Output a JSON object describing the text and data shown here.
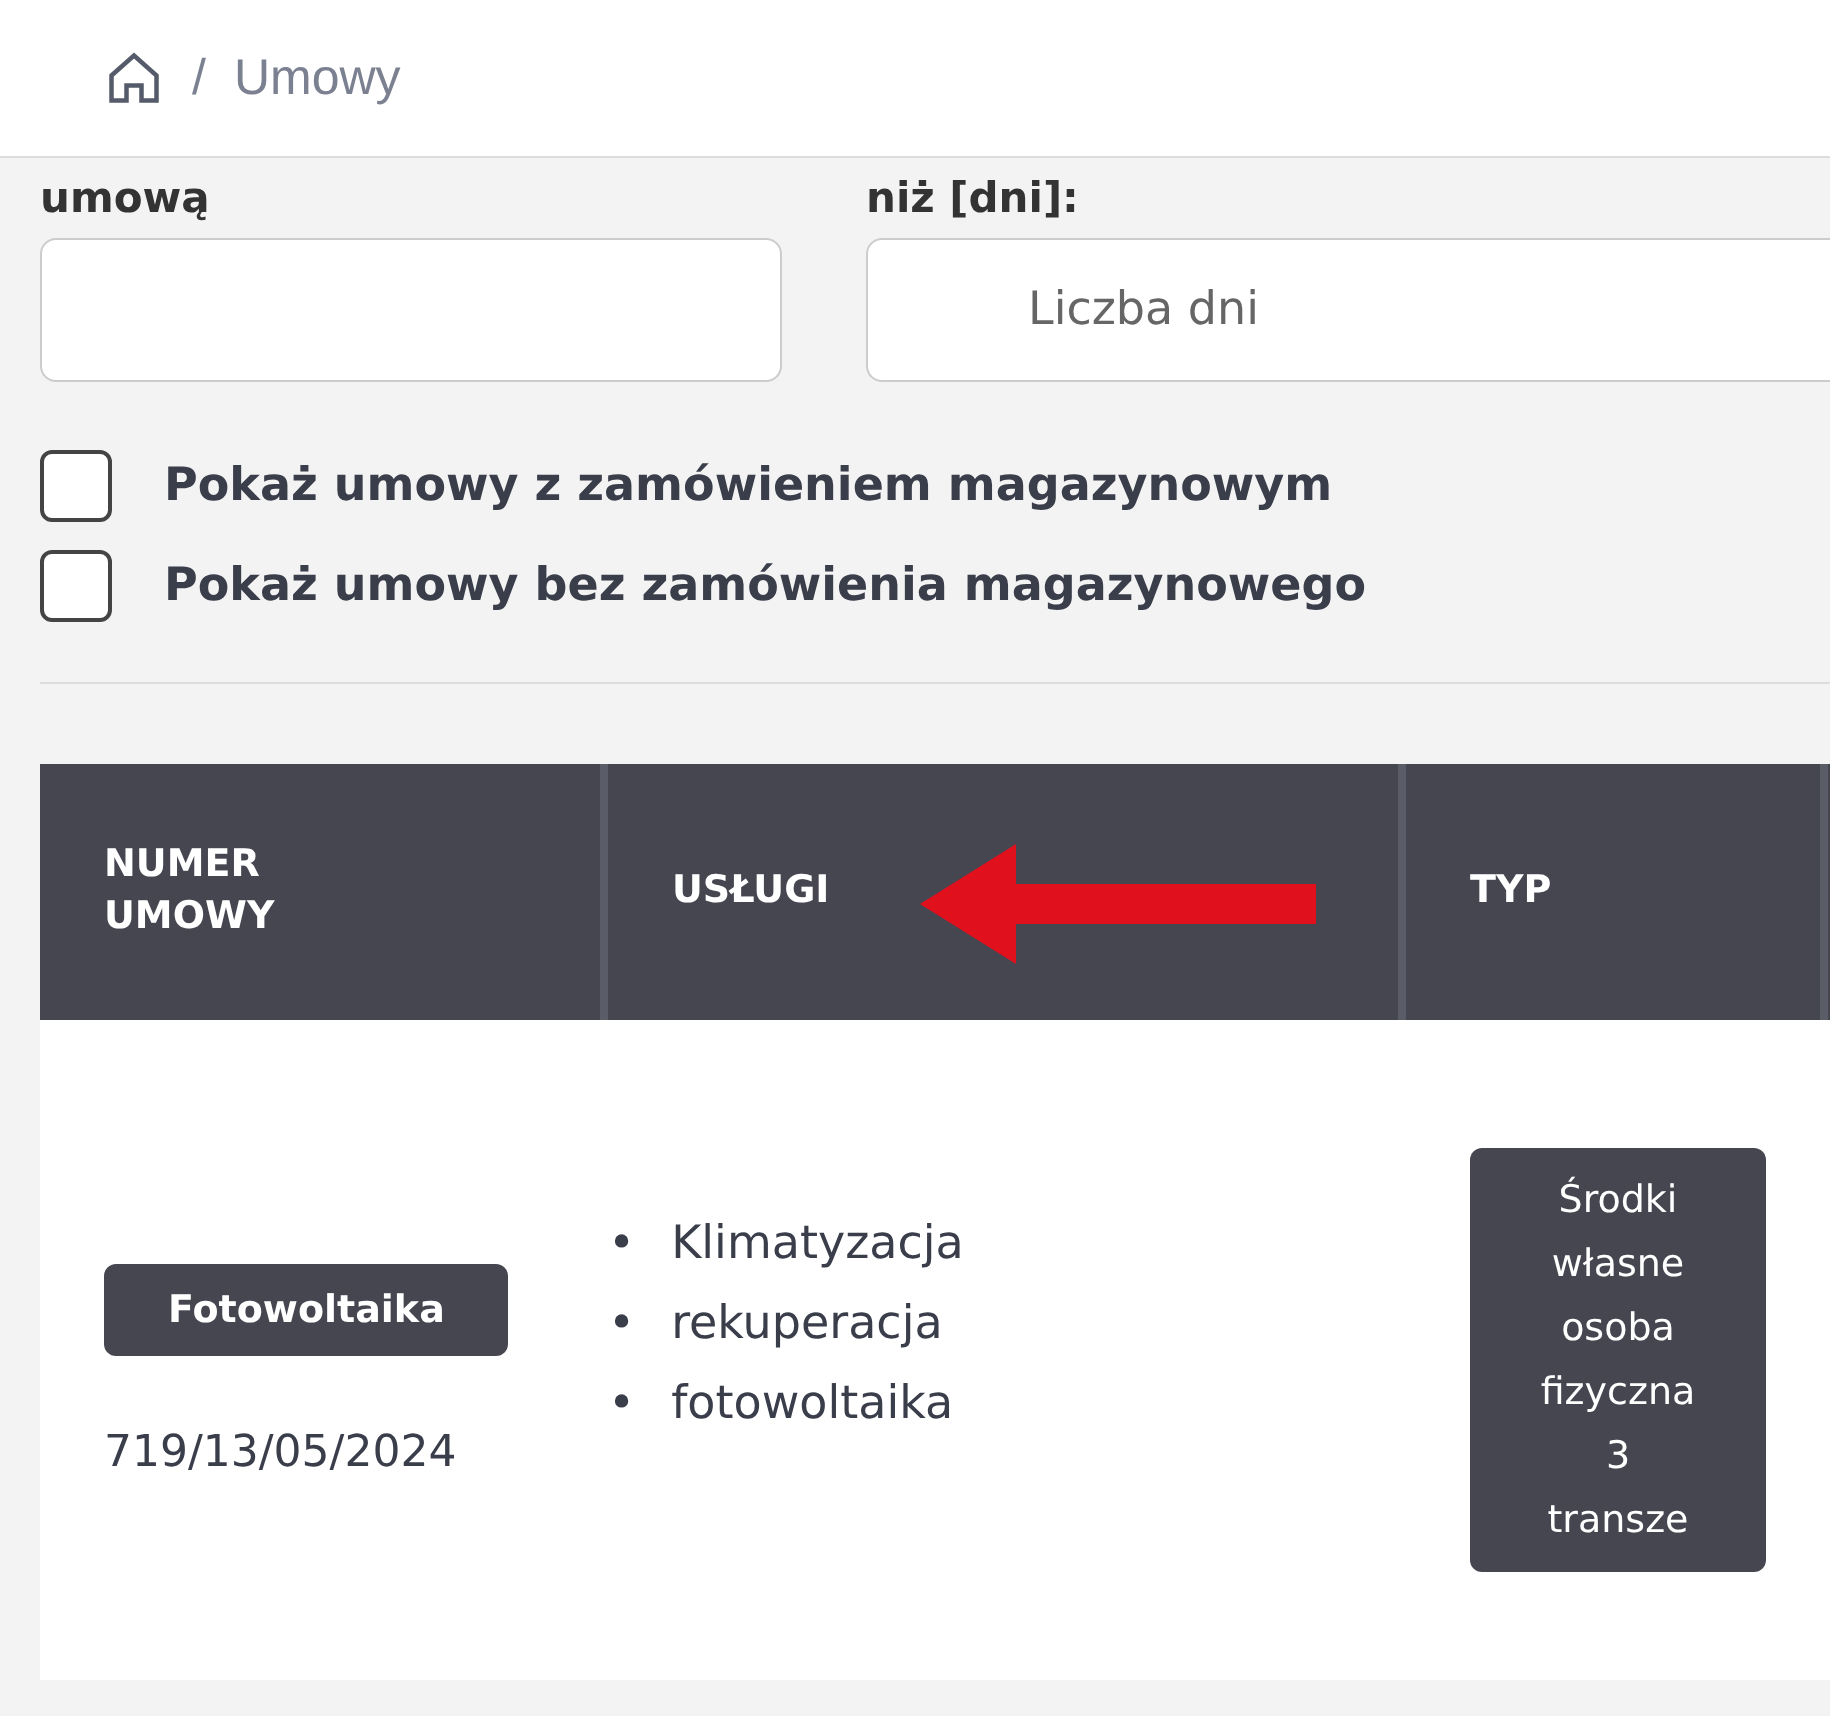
{
  "breadcrumb": {
    "separator": "/",
    "current": "Umowy"
  },
  "filters": {
    "fields": [
      {
        "label": "umową"
      },
      {
        "label": "niż [dni]:",
        "placeholder": "Liczba dni"
      }
    ],
    "checkboxes": [
      {
        "label": "Pokaż umowy z zamówieniem magazynowym",
        "checked": false
      },
      {
        "label": "Pokaż umowy bez zamówienia magazynowego",
        "checked": false
      }
    ]
  },
  "table": {
    "columns": [
      "NUMER UMOWY",
      "USŁUGI",
      "TYP"
    ],
    "rows": [
      {
        "tag": "Fotowoltaika",
        "number": "719/13/05/2024",
        "services": [
          {
            "bullet": "•",
            "text": "Klimatyzacja"
          },
          {
            "bullet": "•",
            "text": "rekuperacja"
          },
          {
            "bullet": "•",
            "text": "fotowoltaika"
          }
        ],
        "type_lines": [
          "Środki",
          "własne",
          "osoba",
          "fizyczna",
          "3",
          "transze"
        ]
      }
    ]
  }
}
